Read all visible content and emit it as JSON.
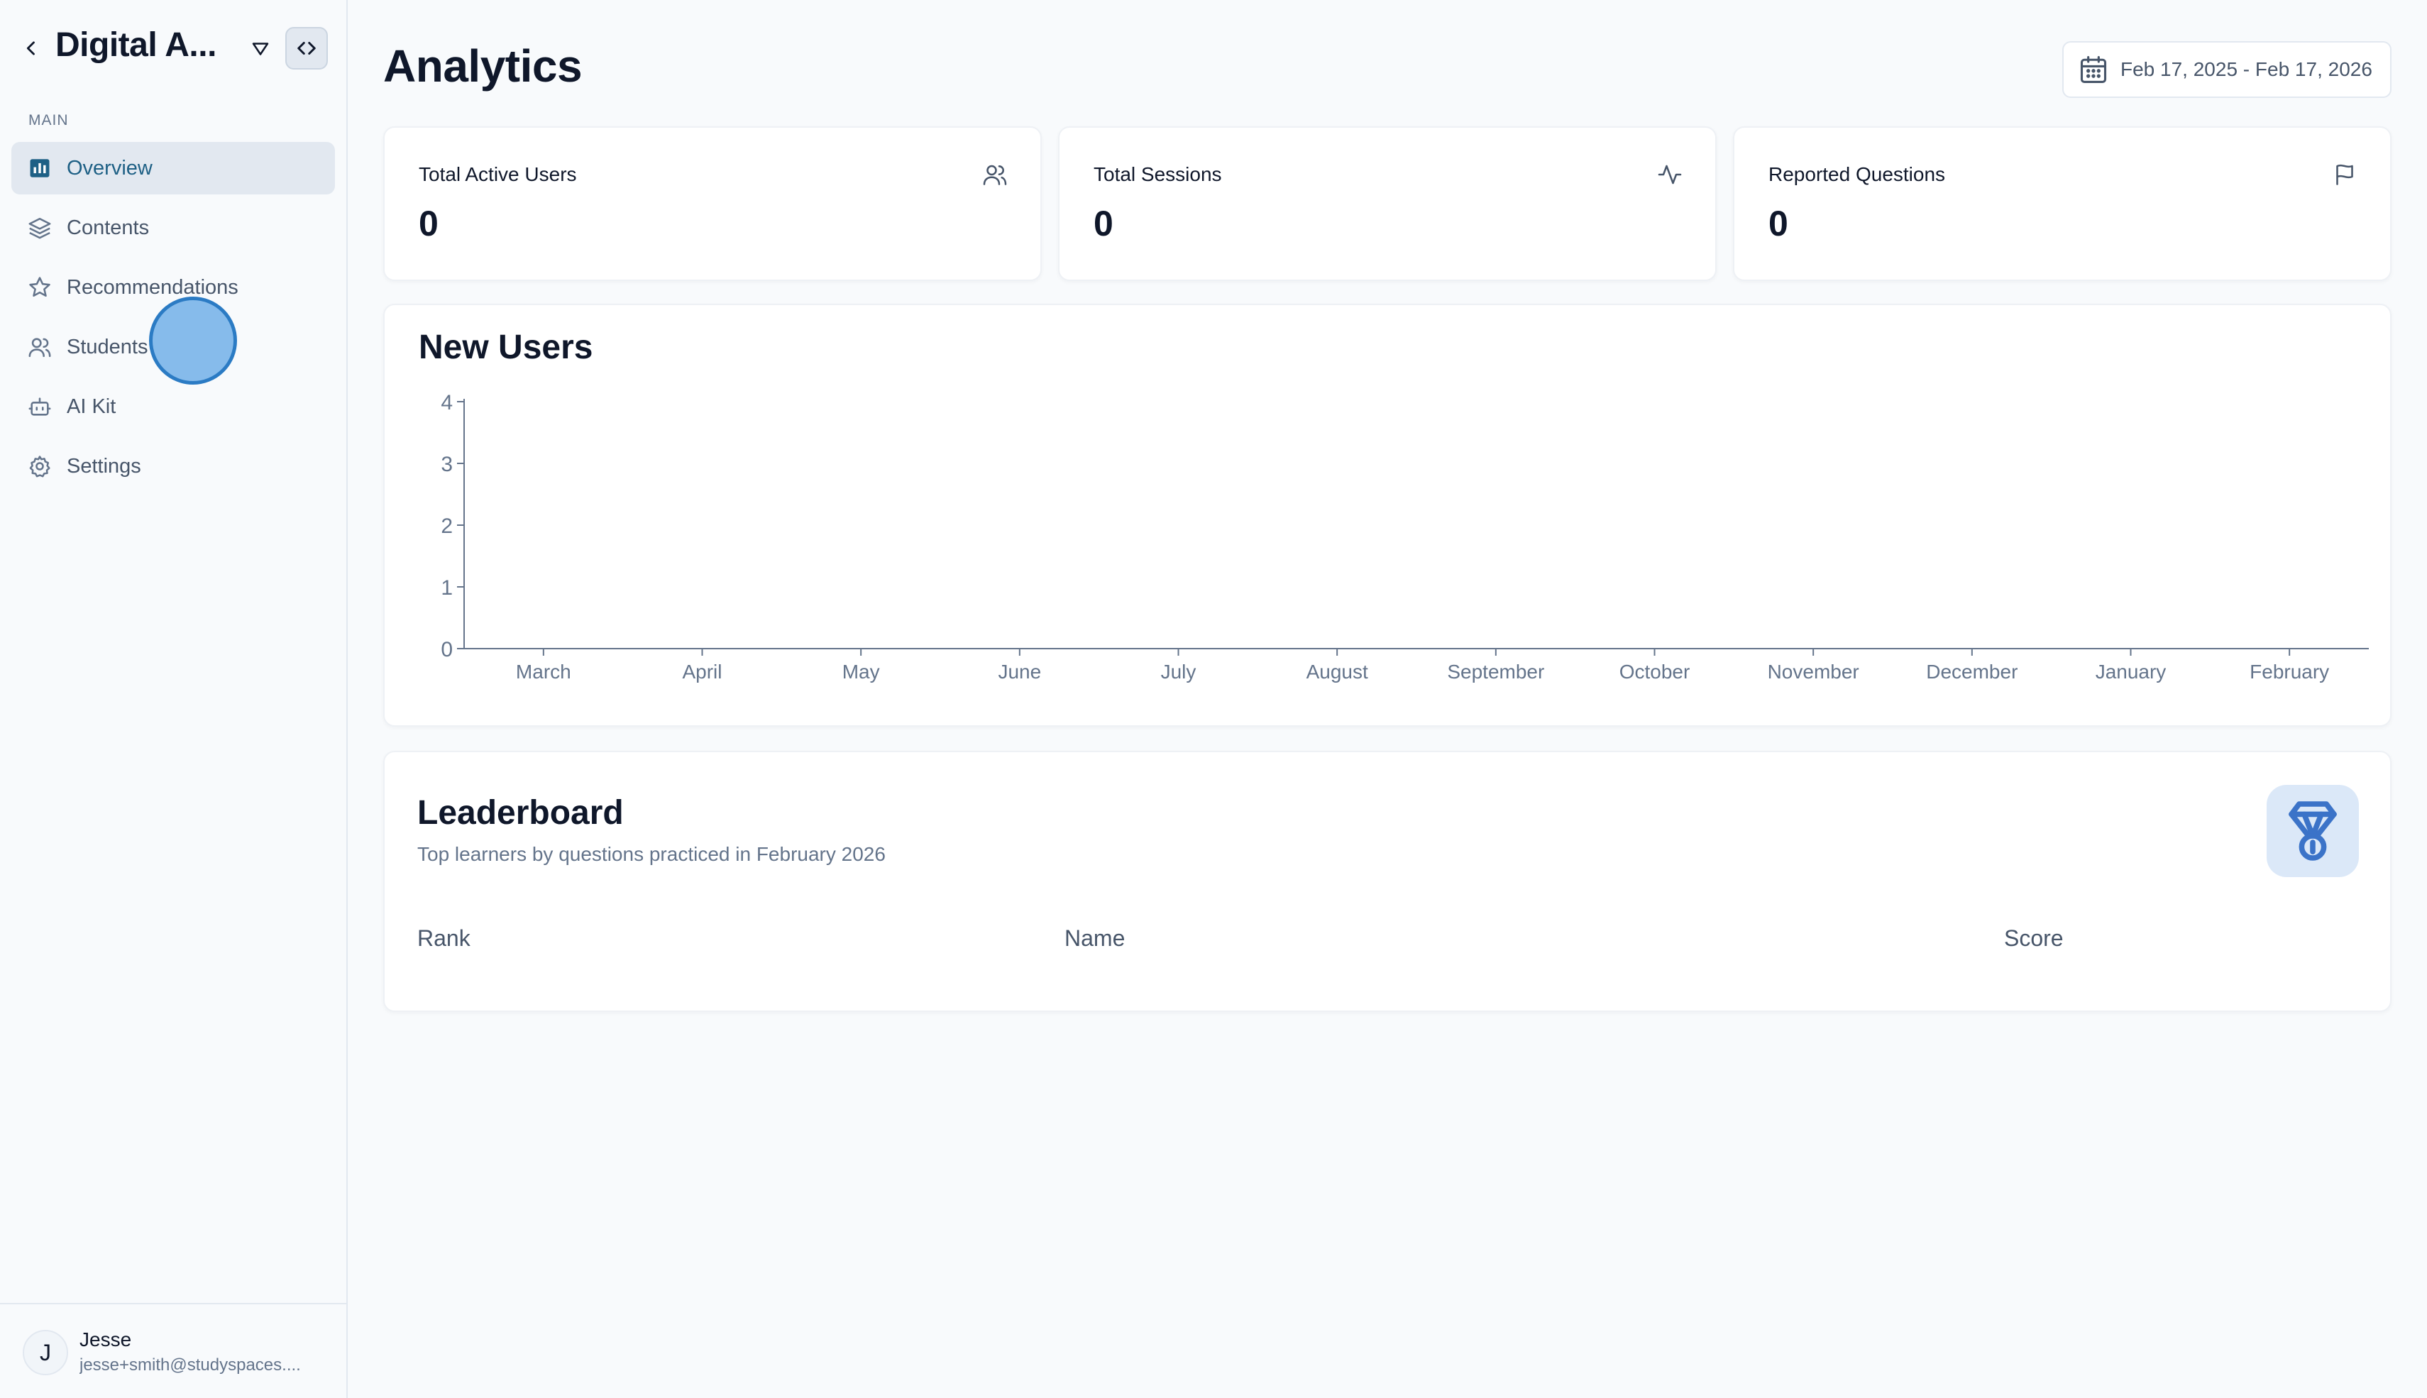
{
  "sidebar": {
    "app_title": "Digital A...",
    "section_label": "MAIN",
    "items": [
      {
        "label": "Overview",
        "icon": "chart-icon",
        "active": true
      },
      {
        "label": "Contents",
        "icon": "layers-icon",
        "active": false
      },
      {
        "label": "Recommendations",
        "icon": "star-icon",
        "active": false
      },
      {
        "label": "Students",
        "icon": "users-icon",
        "active": false
      },
      {
        "label": "AI Kit",
        "icon": "bot-icon",
        "active": false
      },
      {
        "label": "Settings",
        "icon": "gear-icon",
        "active": false
      }
    ],
    "user": {
      "initial": "J",
      "name": "Jesse",
      "email": "jesse+smith@studyspaces...."
    }
  },
  "header": {
    "title": "Analytics",
    "date_range": "Feb 17, 2025 - Feb 17, 2026"
  },
  "stats": [
    {
      "label": "Total Active Users",
      "value": "0",
      "icon": "users-icon"
    },
    {
      "label": "Total Sessions",
      "value": "0",
      "icon": "activity-icon"
    },
    {
      "label": "Reported Questions",
      "value": "0",
      "icon": "flag-icon"
    }
  ],
  "chart_data": {
    "type": "line",
    "title": "New Users",
    "categories": [
      "March",
      "April",
      "May",
      "June",
      "July",
      "August",
      "September",
      "October",
      "November",
      "December",
      "January",
      "February"
    ],
    "series": [
      {
        "values": [
          0,
          0,
          0,
          0,
          0,
          0,
          0,
          0,
          0,
          0,
          0,
          0
        ]
      }
    ],
    "yticks": [
      "0",
      "1",
      "2",
      "3",
      "4"
    ],
    "ylim": [
      0,
      4
    ],
    "grid": false,
    "legend": "none"
  },
  "leaderboard": {
    "title": "Leaderboard",
    "subtitle": "Top learners by questions practiced in February 2026",
    "columns": [
      "Rank",
      "Name",
      "Score"
    ],
    "badge_icon": "medal-icon",
    "rows": []
  },
  "colors": {
    "accent": "#1e6085",
    "active_bg": "#e2e8f0",
    "badge_bg": "#dbe8f8",
    "badge_icon": "#3b73c8"
  }
}
